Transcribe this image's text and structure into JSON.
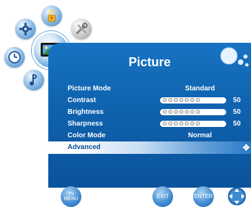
{
  "menu": {
    "title": "Picture",
    "rows": [
      {
        "label": "Picture Mode",
        "value": "Standard"
      },
      {
        "label": "Contrast",
        "value": "50",
        "level": 0.5
      },
      {
        "label": "Brightness",
        "value": "50",
        "level": 0.5
      },
      {
        "label": "Sharpness",
        "value": "50",
        "level": 0.5
      },
      {
        "label": "Color Mode",
        "value": "Normal"
      },
      {
        "label": "Advanced"
      }
    ],
    "selected_index": 5
  },
  "buttons": {
    "tv_menu": "TV\nMENU",
    "exit": "EXIT",
    "enter": "ENTER"
  },
  "icons": {
    "lock": "lock-icon",
    "settings": "gear-icon",
    "tools": "tools-icon",
    "time": "clock-icon",
    "picture": "tv-picture-icon",
    "audio": "music-note-icon",
    "bubbles": "bubbles-icon",
    "dpad": "dpad-icon"
  },
  "colors": {
    "panel": "#0f62ae",
    "selected_text": "#0d4f93",
    "accent": "#3c86c8"
  }
}
